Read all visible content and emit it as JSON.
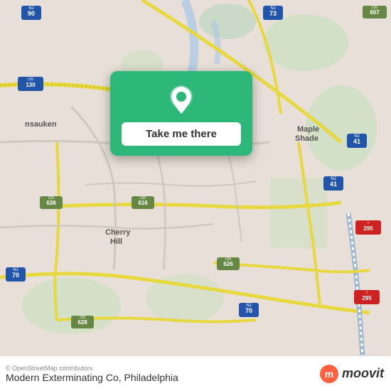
{
  "map": {
    "background_color": "#e8e0d8"
  },
  "popup": {
    "background_color": "#2db87a",
    "button_label": "Take me there",
    "pin_icon": "location-pin"
  },
  "bottom_bar": {
    "attribution": "© OpenStreetMap contributors",
    "place_name": "Modern Exterminating Co, Philadelphia",
    "logo_text": "moovit"
  }
}
